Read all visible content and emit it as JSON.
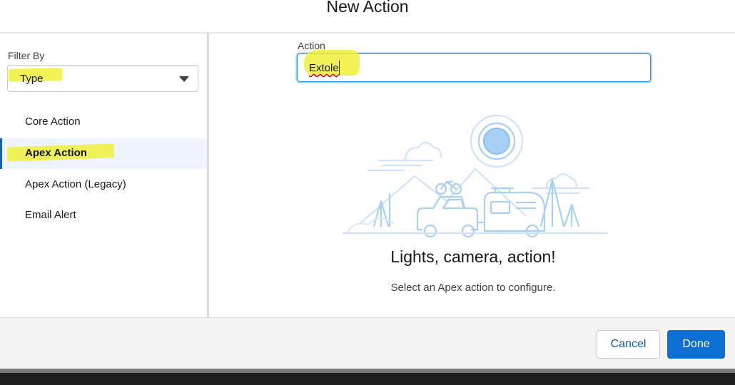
{
  "modal": {
    "title": "New Action"
  },
  "sidebar": {
    "filter_label": "Filter By",
    "filter_value": "Type",
    "items": [
      {
        "label": "Core Action",
        "active": false
      },
      {
        "label": "Apex Action",
        "active": true
      },
      {
        "label": "Apex Action (Legacy)",
        "active": false
      },
      {
        "label": "Email Alert",
        "active": false
      }
    ]
  },
  "main": {
    "action_label": "Action",
    "action_value": "Extole",
    "empty_title": "Lights, camera, action!",
    "empty_subtitle": "Select an Apex action to configure.",
    "illustration": "camping-trailer-illustration"
  },
  "footer": {
    "cancel_label": "Cancel",
    "done_label": "Done"
  },
  "colors": {
    "accent": "#0b6fd3",
    "highlight": "#f0f03a",
    "illustration": "#a8cff5"
  }
}
